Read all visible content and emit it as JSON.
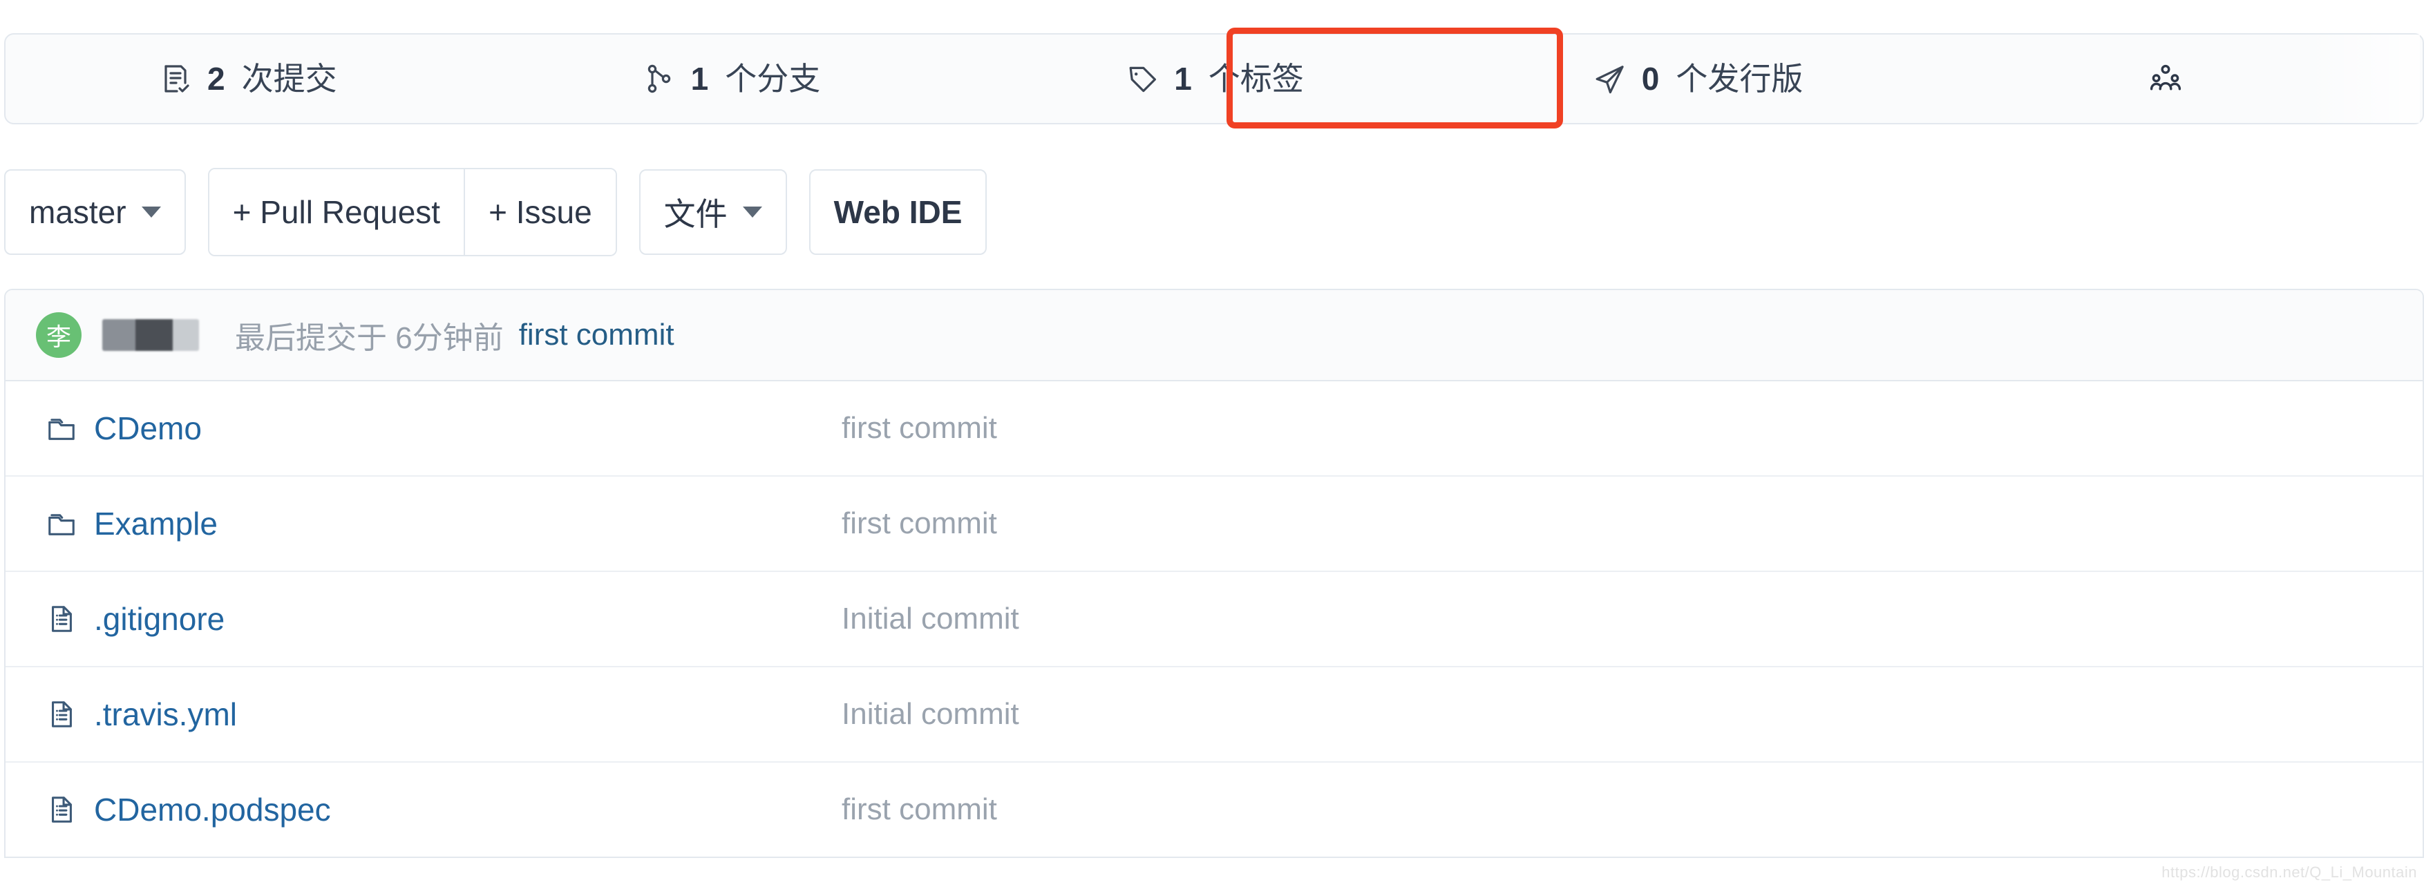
{
  "stats": {
    "items": [
      {
        "icon": "commit-history-icon",
        "num": "2",
        "label": "次提交",
        "name": "stat-commits"
      },
      {
        "icon": "git-branch-icon",
        "num": "1",
        "label": "个分支",
        "name": "stat-branches"
      },
      {
        "icon": "tag-icon",
        "num": "1",
        "label": "个标签",
        "name": "stat-tags"
      },
      {
        "icon": "release-rocket-icon",
        "num": "0",
        "label": "个发行版",
        "name": "stat-releases"
      },
      {
        "icon": "contributors-people-icon",
        "num": "",
        "label": "",
        "name": "stat-contributors"
      }
    ],
    "highlight_color": "#f04124",
    "highlighted_item": "stat-tags"
  },
  "toolbar": {
    "branch_label": "master",
    "pull_request_label": "+ Pull Request",
    "issue_label": "+ Issue",
    "files_label": "文件",
    "web_ide_label": "Web IDE"
  },
  "commit_header": {
    "avatar_initial": "李",
    "avatar_color": "#68c074",
    "author_redacted": true,
    "meta_text": "最后提交于 6分钟前",
    "message": "first commit"
  },
  "files": [
    {
      "type": "folder",
      "icon": "folder-icon",
      "name": "CDemo",
      "commit": "first commit"
    },
    {
      "type": "folder",
      "icon": "folder-icon",
      "name": "Example",
      "commit": "first commit"
    },
    {
      "type": "file",
      "icon": "file-icon",
      "name": ".gitignore",
      "commit": "Initial commit"
    },
    {
      "type": "file",
      "icon": "file-icon",
      "name": ".travis.yml",
      "commit": "Initial commit"
    },
    {
      "type": "file",
      "icon": "file-icon",
      "name": "CDemo.podspec",
      "commit": "first commit"
    }
  ],
  "watermark": "https://blog.csdn.net/Q_Li_Mountain"
}
